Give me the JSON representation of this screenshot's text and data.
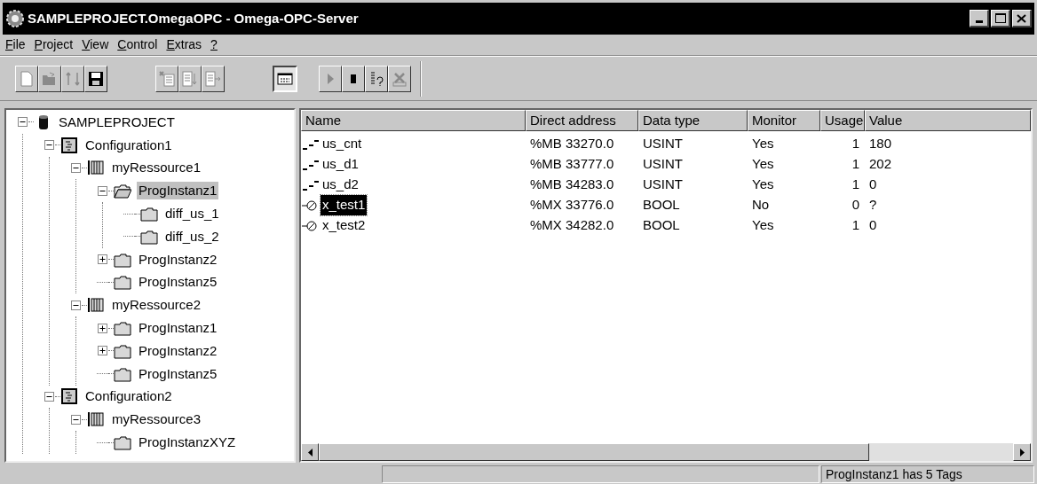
{
  "window": {
    "title": "SAMPLEPROJECT.OmegaOPC - Omega-OPC-Server"
  },
  "menu": [
    "File",
    "Project",
    "View",
    "Control",
    "Extras",
    "?"
  ],
  "toolbar": [
    [
      {
        "kind": "new",
        "disabled": true,
        "pressed": false
      },
      {
        "kind": "open",
        "disabled": true,
        "pressed": false
      },
      {
        "kind": "sync",
        "disabled": true,
        "pressed": false
      },
      {
        "kind": "save",
        "disabled": false,
        "pressed": false
      }
    ],
    [
      {
        "kind": "paste",
        "disabled": true,
        "pressed": false
      },
      {
        "kind": "import",
        "disabled": true,
        "pressed": false
      },
      {
        "kind": "export",
        "disabled": true,
        "pressed": false
      }
    ],
    [
      {
        "kind": "window",
        "disabled": false,
        "pressed": true
      }
    ],
    [
      {
        "kind": "play",
        "disabled": true,
        "pressed": false
      },
      {
        "kind": "stop",
        "disabled": false,
        "pressed": false
      },
      {
        "kind": "query",
        "disabled": false,
        "pressed": false
      },
      {
        "kind": "tool",
        "disabled": true,
        "pressed": false
      }
    ]
  ],
  "tree": [
    {
      "label": "SAMPLEPROJECT",
      "kind": "database",
      "expanded": true,
      "selected": false,
      "children": [
        {
          "label": "Configuration1",
          "kind": "configuration",
          "expanded": true,
          "selected": false,
          "children": [
            {
              "label": "myRessource1",
              "kind": "resource",
              "expanded": true,
              "selected": false,
              "children": [
                {
                  "label": "ProgInstanz1",
                  "kind": "folder",
                  "expanded": true,
                  "selected": true,
                  "children": [
                    {
                      "label": "diff_us_1",
                      "kind": "folder",
                      "selected": false
                    },
                    {
                      "label": "diff_us_2",
                      "kind": "folder",
                      "selected": false
                    }
                  ]
                },
                {
                  "label": "ProgInstanz2",
                  "kind": "folder",
                  "expanded": false,
                  "selected": false
                },
                {
                  "label": "ProgInstanz5",
                  "kind": "folder",
                  "selected": false
                }
              ]
            },
            {
              "label": "myRessource2",
              "kind": "resource",
              "expanded": true,
              "selected": false,
              "children": [
                {
                  "label": "ProgInstanz1",
                  "kind": "folder",
                  "expanded": false,
                  "selected": false
                },
                {
                  "label": "ProgInstanz2",
                  "kind": "folder",
                  "expanded": false,
                  "selected": false
                },
                {
                  "label": "ProgInstanz5",
                  "kind": "folder",
                  "selected": false
                }
              ]
            }
          ]
        },
        {
          "label": "Configuration2",
          "kind": "configuration",
          "expanded": true,
          "selected": false,
          "children": [
            {
              "label": "myRessource3",
              "kind": "resource",
              "expanded": true,
              "selected": false,
              "children": [
                {
                  "label": "ProgInstanzXYZ",
                  "kind": "folder",
                  "selected": false
                }
              ]
            }
          ]
        }
      ]
    }
  ],
  "table": {
    "columns": [
      "Name",
      "Direct address",
      "Data type",
      "Monitor",
      "Usage",
      "Value"
    ],
    "rows": [
      {
        "kind": "analog",
        "selected": false,
        "cells": [
          "us_cnt",
          "%MB 33270.0",
          "USINT",
          "Yes",
          "1",
          "180"
        ]
      },
      {
        "kind": "analog",
        "selected": false,
        "cells": [
          "us_d1",
          "%MB 33777.0",
          "USINT",
          "Yes",
          "1",
          "202"
        ]
      },
      {
        "kind": "analog",
        "selected": false,
        "cells": [
          "us_d2",
          "%MB 34283.0",
          "USINT",
          "Yes",
          "1",
          "0"
        ]
      },
      {
        "kind": "bool",
        "selected": true,
        "cells": [
          "x_test1",
          "%MX 33776.0",
          "BOOL",
          "No",
          "0",
          "?"
        ]
      },
      {
        "kind": "bool",
        "selected": false,
        "cells": [
          "x_test2",
          "%MX 34282.0",
          "BOOL",
          "Yes",
          "1",
          "0"
        ]
      }
    ]
  },
  "status_bar": {
    "message": "ProgInstanz1 has 5 Tags"
  }
}
